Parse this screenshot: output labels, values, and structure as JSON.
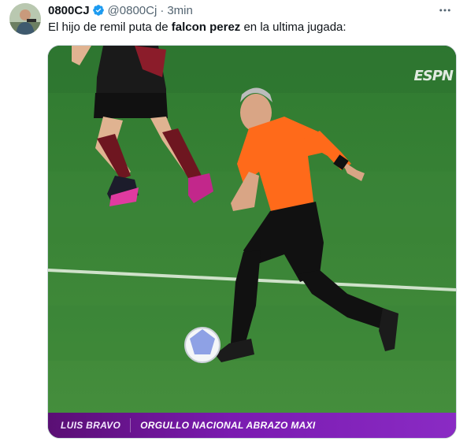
{
  "author": {
    "display_name": "0800CJ",
    "handle": "@0800Cj",
    "separator": "·",
    "timestamp": "3min",
    "verified": true,
    "avatar_icon": "avatar-photo"
  },
  "tweet": {
    "text_before": "El hijo de remil puta de ",
    "text_bold": "falcon perez",
    "text_after": " en la ultima jugada:"
  },
  "media": {
    "network_logo": "ESPN",
    "lower_third": {
      "name": "LUIS BRAVO",
      "headline": "ORGULLO NACIONAL ABRAZO MAXI"
    }
  },
  "icons": {
    "verified": "verified-badge-icon",
    "more": "more-options-icon"
  },
  "colors": {
    "verified_blue": "#1d9bf0",
    "secondary_text": "#536471",
    "lower_third_purple": "#7a1bb0",
    "referee_shirt": "#ff6a1a",
    "pitch_green": "#3e8b3a"
  }
}
